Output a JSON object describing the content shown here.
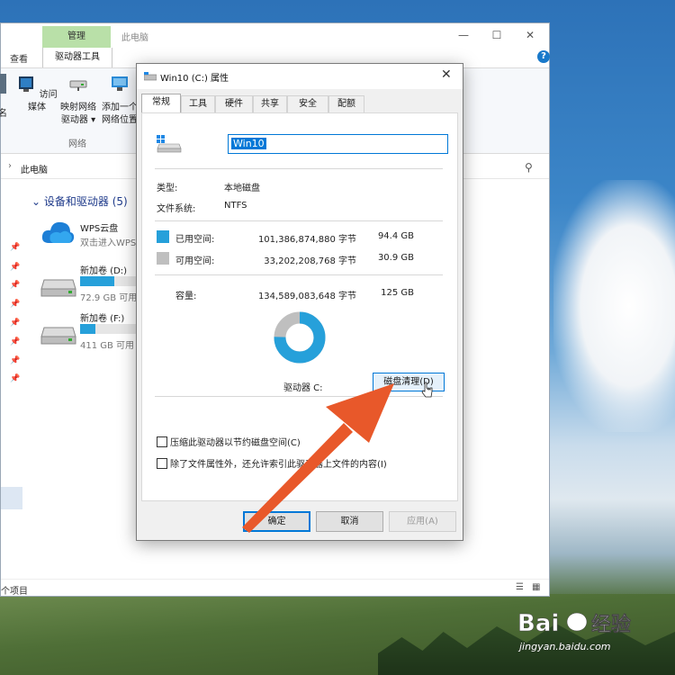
{
  "explorer": {
    "title": "此电脑",
    "manage_tab": "管理",
    "ribbon_tabs": [
      "查看",
      "驱动器工具"
    ],
    "ribbon_buttons": [
      {
        "label1": "访问媒体",
        "label2": ""
      },
      {
        "label1": "映射网络",
        "label2": "驱动器 ▾"
      },
      {
        "label1": "添加一个",
        "label2": "网络位置"
      }
    ],
    "ribbon_left_fragment": "名",
    "ribbon_group": "网络",
    "address": "此电脑",
    "section": "设备和驱动器 (5)",
    "drives": [
      {
        "name": "WPS云盘",
        "sub": "双击进入WPS",
        "fill": null
      },
      {
        "name": "新加卷 (D:)",
        "sub": "72.9 GB 可用",
        "fill": 0.62
      },
      {
        "name": "新加卷 (F:)",
        "sub": "411 GB 可用",
        "fill": 0.28
      }
    ],
    "status": "个项目"
  },
  "dialog": {
    "title": "Win10 (C:) 属性",
    "tabs": [
      "常规",
      "工具",
      "硬件",
      "共享",
      "安全",
      "配额"
    ],
    "active_tab": "常规",
    "name_value": "Win10",
    "type_label": "类型:",
    "type_value": "本地磁盘",
    "fs_label": "文件系统:",
    "fs_value": "NTFS",
    "used_label": "已用空间:",
    "used_bytes": "101,386,874,880 字节",
    "used_gb": "94.4 GB",
    "free_label": "可用空间:",
    "free_bytes": "33,202,208,768 字节",
    "free_gb": "30.9 GB",
    "cap_label": "容量:",
    "cap_bytes": "134,589,083,648 字节",
    "cap_gb": "125 GB",
    "used_fraction": 0.753,
    "drive_label": "驱动器 C:",
    "cleanup_button": "磁盘清理(D)",
    "compress_label": "压缩此驱动器以节约磁盘空间(C)",
    "index_label": "除了文件属性外，还允许索引此驱动器上文件的内容(I)",
    "ok_button": "确定",
    "cancel_button": "取消",
    "apply_button": "应用(A)",
    "colors": {
      "used": "#26a0da",
      "free": "#bfbfbf"
    }
  },
  "watermark": {
    "brand": "Bai 经验",
    "url": "jingyan.baidu.com"
  }
}
